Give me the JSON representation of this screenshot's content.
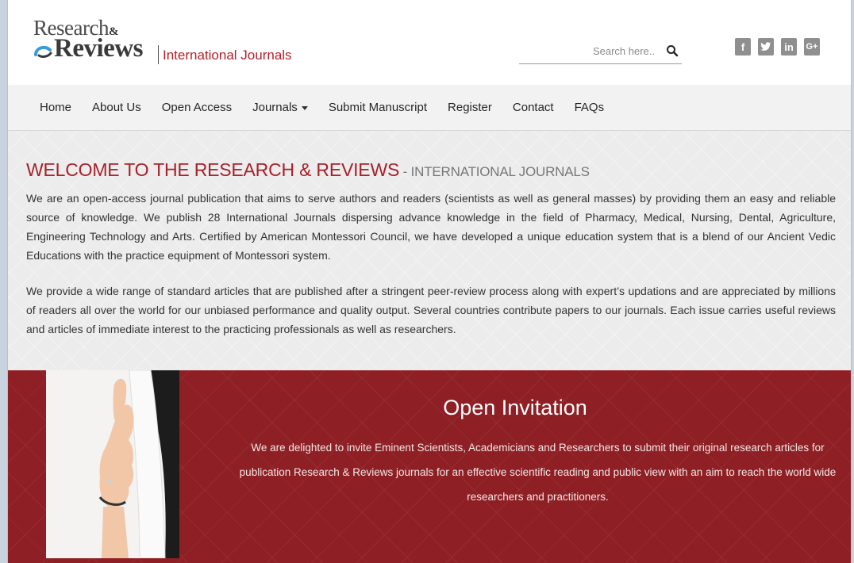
{
  "header": {
    "logo_research": "Research",
    "logo_amp": "&",
    "logo_reviews": "Reviews",
    "logo_tagline": "International Journals",
    "search_placeholder": "Search here..",
    "search_icon": "search-icon",
    "social": [
      {
        "name": "facebook",
        "glyph": "f"
      },
      {
        "name": "twitter",
        "glyph": "t"
      },
      {
        "name": "linkedin",
        "glyph": "in"
      },
      {
        "name": "google-plus",
        "glyph": "G+"
      }
    ]
  },
  "nav": {
    "items": [
      "Home",
      "About Us",
      "Open Access",
      "Journals",
      "Submit Manuscript",
      "Register",
      "Contact",
      "FAQs"
    ]
  },
  "welcome": {
    "title": "WELCOME TO THE RESEARCH & REVIEWS",
    "subtitle": " - INTERNATIONAL JOURNALS",
    "paragraph1": "We are an open-access journal publication that aims to serve authors and readers (scientists as well as general masses) by providing them an easy and reliable source of knowledge. We publish 28 International Journals dispersing advance knowledge in the field of Pharmacy, Medical, Nursing, Dental, Agriculture, Engineering Technology and Arts. Certified by American Montessori Council, we have developed a unique education system that is a blend of our Ancient Vedic Educations with the practice equipment of Montessori system.",
    "paragraph2": "We provide a wide range of standard articles that are published after a stringent peer-review process along with expert’s updations and are appreciated by millions of readers all over the world for our unbiased performance and quality output. Several countries contribute papers to our journals. Each issue carries useful reviews and articles of immediate interest to the practicing professionals as well as researchers."
  },
  "invitation": {
    "title": "Open Invitation",
    "text": "We are delighted to invite Eminent Scientists, Academicians and Researchers to submit their original research articles for publication Research & Reviews journals for an effective scientific reading and public view with an aim to reach the world wide researchers and practitioners."
  },
  "colors": {
    "brand_red": "#a8202a",
    "banner_red": "#8e2025",
    "nav_bg": "#f2f2f2"
  }
}
